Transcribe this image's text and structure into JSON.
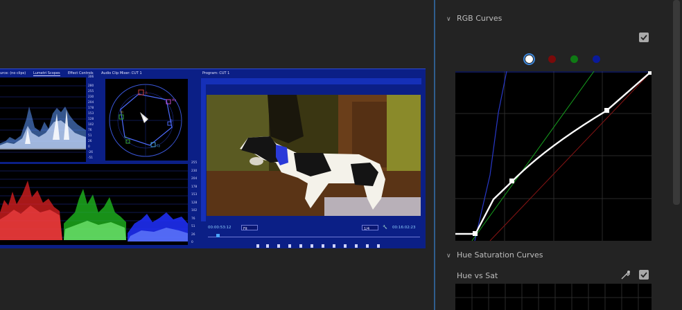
{
  "embedded_screenshot": {
    "source_tab": "urce: (no clips)",
    "lumetri_tab": "Lumetri Scopes",
    "effect_controls_tab": "Effect Controls",
    "audio_mixer_tab": "Audio Clip Mixer: CUT 1",
    "program_title": "Program: CUT 1",
    "waveform_scale": [
      "306",
      "280",
      "255",
      "230",
      "204",
      "178",
      "153",
      "128",
      "102",
      "76",
      "51",
      "26",
      "0",
      "-26",
      "-51"
    ],
    "parade_scale": [
      "255",
      "230",
      "204",
      "178",
      "153",
      "128",
      "102",
      "76",
      "51",
      "26",
      "0"
    ],
    "vectorscope_labels": [
      "R",
      "Mg",
      "B",
      "Cy",
      "G",
      "Yl"
    ],
    "timecode_current": "00:00:53:12",
    "zoom_select": "Fit",
    "resolution_select": "1/4",
    "timecode_duration": "00:16:02:23"
  },
  "rgb_curves": {
    "header": "RGB Curves",
    "enabled": true,
    "channels": [
      {
        "name": "white",
        "color": "#ffffff",
        "selected": true
      },
      {
        "name": "red",
        "color": "#7a0a0a",
        "selected": false
      },
      {
        "name": "green",
        "color": "#0f7a14",
        "selected": false
      },
      {
        "name": "blue",
        "color": "#0a1a9a",
        "selected": false
      }
    ]
  },
  "hue_saturation_curves": {
    "header": "Hue Saturation Curves",
    "sub_label": "Hue vs Sat",
    "enabled": true
  },
  "colors": {
    "panel_bg": "#232323",
    "accent_blue": "#3d86d9",
    "scope_blue": "#0b1f86"
  }
}
